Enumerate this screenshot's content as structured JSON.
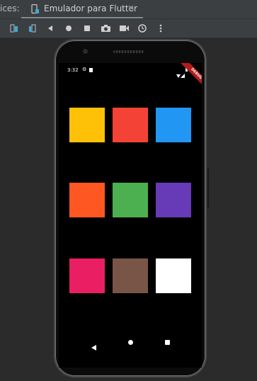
{
  "tab_bar": {
    "prefix_label": "ices:",
    "active_tab": {
      "label": "Emulador para Flutter",
      "icon": "phone-icon",
      "close_icon": "close-icon",
      "close_glyph": "×"
    }
  },
  "toolbar": {
    "buttons": [
      "rotate-left-icon",
      "rotate-right-icon",
      "back-icon",
      "home-icon",
      "overview-icon",
      "camera-icon",
      "video-icon",
      "snapshot-icon",
      "more-options-icon"
    ]
  },
  "device": {
    "status_bar": {
      "time": "3:32",
      "settings_glyph": "⚙"
    },
    "debug_banner": "DEBUG",
    "squares": [
      {
        "color": "#FFC107"
      },
      {
        "color": "#F44336"
      },
      {
        "color": "#2196F3"
      },
      {
        "color": "#FF5722"
      },
      {
        "color": "#4CAF50"
      },
      {
        "color": "#673AB7"
      },
      {
        "color": "#E91E63"
      },
      {
        "color": "#795548"
      },
      {
        "color": "#FFFFFF"
      }
    ],
    "nav_bar": [
      "back-icon",
      "home-icon",
      "recents-icon"
    ]
  }
}
